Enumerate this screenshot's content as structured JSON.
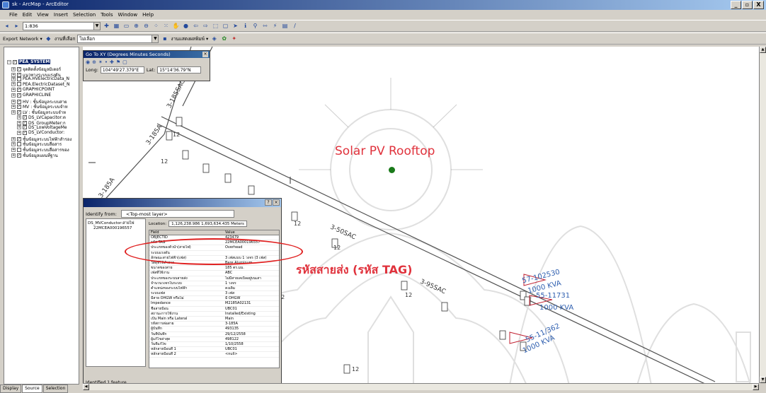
{
  "window": {
    "title": "sk - ArcMap - ArcEditor",
    "buttons": [
      "_",
      "▫",
      "X"
    ]
  },
  "menu": [
    "File",
    "Edit",
    "View",
    "Insert",
    "Selection",
    "Tools",
    "Window",
    "Help"
  ],
  "toolbar1": {
    "scale": "1:836"
  },
  "toolbar2": {
    "network_label": "Export Network ▾",
    "select_label": "งานที่เลือก",
    "select_value": "ไม่เลือก",
    "layer_label": "งานแสดงผลพิมพ์ ▾"
  },
  "goto_xy": {
    "title": "Go To XY   (Degrees Minutes Seconds)",
    "long_label": "Long:",
    "long_value": "104°49'27.379\"E",
    "lat_label": "Lat:",
    "lat_value": "15°14'36.79\"N"
  },
  "toc": {
    "root": "PEA_SYSTEM",
    "items": [
      "จุดติดตั้งข้อมูลมิเตอร์",
      "แนวทางระบบแรงดัน",
      "PEA.HVElectricData_N",
      "PEA.ElectricDataset_N",
      "GRAPHICPOINT",
      "GRAPHICLINE",
      "HV : ชั้นข้อมูลระบบสาย",
      "MV : ชั้นข้อมูลระบบจำห",
      "LV : ชั้นข้อมูลระบบจำห",
      "DS_LVCapacitor:ต",
      "DS_GroupMeter:ก",
      "DS_LowVoltageMe",
      "DS_LVConductor:",
      "ชั้นข้อมูลระบบไฟฟ้าสำรอง",
      "ชั้นข้อมูลระบบสื่อสาร",
      "ชั้นข้อมูลระบบสื่อสารของ",
      "ชั้นข้อมูลแผนที่ฐาน"
    ],
    "tabs": [
      "Display",
      "Source",
      "Selection"
    ]
  },
  "identify": {
    "identify_from_label": "Identify from:",
    "identify_from_value": "<Top-most layer>",
    "tree_parent": "DS_MVConductor:สายไฟ",
    "tree_child": "22MCEA000196557",
    "location_label": "Location:",
    "location_value": "1,126,238.986  1,693,634.435 Meters",
    "col_field": "Field",
    "col_value": "Value",
    "rows": [
      [
        "OBJECTID",
        "423479"
      ],
      [
        "รหัส TAG",
        "22MCEA000196557"
      ],
      [
        "ประเภทของตัวนำ(สายไฟ)",
        "Overhead"
      ],
      [
        "ระบบแรงดัน",
        ""
      ],
      [
        "ลักษณะสายไฟฟ้า(เฟส)",
        "3 เฟสแบบ 1 วงจร (3 เฟส)"
      ],
      [
        "วัสดุที่ใช้ทำสาย",
        "Bare Aluminum"
      ],
      [
        "ขนาดของสาย",
        "185 ตร.มม."
      ],
      [
        "เฟสที่ใช้งาน",
        "ABC"
      ],
      [
        "ประเภทของระบบสายส่ง",
        "ไม่มีสายเคเบิลอยู่บนเสา"
      ],
      [
        "จำนวนวงจรในระบบ",
        "1 วงจร"
      ],
      [
        "ตำแหน่งของระบบไฟฟ้า",
        "คงเดิม"
      ],
      [
        "ระบบเฟส",
        "3 เฟส"
      ],
      [
        "มีสาย OHGW หรือไม่",
        "มี OHGW"
      ],
      [
        "Impedance",
        "M2185A02131"
      ],
      [
        "ชื่อสายป้อน",
        "UBC01"
      ],
      [
        "สถานะการใช้งาน",
        "Installed/Existing"
      ],
      [
        "เป็น Main หรือ Lateral",
        "Main"
      ],
      [
        "รหัสการต่อสาย",
        "3-185A"
      ],
      [
        "ผู้บันทึก",
        "493135"
      ],
      [
        "วันที่บันทึก",
        "29/12/2558"
      ],
      [
        "ผู้แก้ไขล่าสุด",
        "498122"
      ],
      [
        "วันที่แก้ไข",
        "1/10/2558"
      ],
      [
        "หลักสายป้อนที่ 1",
        "UBC01"
      ],
      [
        "หลักสายป้อนที่ 2",
        "<null>"
      ]
    ],
    "status": "Identified 1 feature"
  },
  "annotations": {
    "solar": "Solar PV Rooftop",
    "tag": "รหัสสายส่ง (รหัส TAG)"
  },
  "map_labels": {
    "line1": "3-185SAC",
    "line2": "3-185A",
    "line3": "3-50SAC",
    "line4": "3-95SAC",
    "tr1_id": "57-102530",
    "tr1_kva": "1000 KVA",
    "tr2_id": "55-11731",
    "tr2_kva": "1000 KVA",
    "tr3_id": "55-11/362",
    "tr3_kva": "1000 KVA",
    "pole": "12"
  },
  "colors": {
    "accent": "#e0323c",
    "line": "#505050",
    "transformer": "#c02030",
    "label_blue": "#3060b0"
  }
}
